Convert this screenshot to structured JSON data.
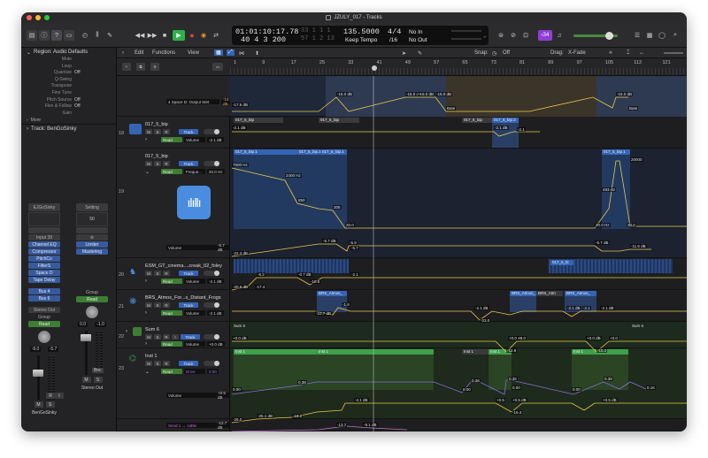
{
  "window": {
    "title": "JZULY_017 - Tracks",
    "traffic_colors": [
      "#fe5f57",
      "#febc2e",
      "#28c840"
    ]
  },
  "control_bar": {
    "lcd": {
      "time": "01:01:10:17.78",
      "time_ghost": "33 1 1 1",
      "bars": "40 4 3 200",
      "bars_ghost": "57 1 2 13",
      "tempo": "135.5000",
      "tempo_mode": "Keep Tempo",
      "signature": "4/4",
      "division": "/16",
      "in": "No In",
      "out": "No Out"
    },
    "count_badge": "‹34",
    "play_color": "#2fb24a",
    "record_color": "#e2403a",
    "badge_color": "#8f3fd4"
  },
  "inspector": {
    "region_header": "Region: Audio Defaults",
    "params": [
      {
        "name": "Mute",
        "value": ""
      },
      {
        "name": "Loop",
        "value": ""
      },
      {
        "name": "Quantize",
        "value": "Off"
      },
      {
        "name": "Q-Swing",
        "value": ""
      },
      {
        "name": "Transpose",
        "value": ""
      },
      {
        "name": "Fine Tune",
        "value": ""
      },
      {
        "name": "Pitch Source",
        "value": "Off"
      },
      {
        "name": "Flex & Follow",
        "value": "Off"
      },
      {
        "name": "Gain",
        "value": ""
      }
    ],
    "more": "More",
    "track_header": "Track: BenGoSinky",
    "strip_left": {
      "eq": "EJGoSinky",
      "input": "Input 39",
      "plugins": [
        "Channel EQ",
        "Compressor",
        "PitchCo",
        "FilterS",
        "Space D",
        "Tape Delay"
      ],
      "sends": [
        "Bus 4",
        "Bus 6"
      ],
      "output": "Stereo Out",
      "group": "Group",
      "automation": "Read",
      "values": [
        "-9.0",
        "-5.7"
      ],
      "name": "BenGoSinky",
      "buttons": [
        "M",
        "S"
      ]
    },
    "strip_right": {
      "eq": "Setting",
      "fx_value": "50",
      "plugins": [
        "Limiter",
        "Mastering"
      ],
      "group": "Group",
      "automation": "Read",
      "values": [
        "0.0",
        "-1.0"
      ],
      "name": "Stereo Out",
      "bnc": "Bnc",
      "buttons": [
        "M",
        "S"
      ]
    }
  },
  "editor_bar": {
    "edit": "Edit",
    "functions": "Functions",
    "view": "View",
    "snap_label": "Snap:",
    "snap_value": "Off",
    "drag_label": "Drag:",
    "drag_value": "X-Fade"
  },
  "ruler": {
    "marks": [
      "1",
      "9",
      "17",
      "25",
      "33",
      "41",
      "49",
      "57",
      "65",
      "73",
      "81",
      "89",
      "97",
      "105",
      "113",
      "121"
    ]
  },
  "tracks": [
    {
      "num": "",
      "name": "",
      "sub": "4 Space D: Output Wet",
      "value": "-14.6 dB"
    },
    {
      "num": "18",
      "name": "017_5_bip",
      "mode": "Read",
      "param": "Volume",
      "value": "-2.1 dB"
    },
    {
      "num": "19",
      "name": "017_5_bip",
      "mode": "Read",
      "param": "Freque...",
      "value": "20.0 Hz",
      "param2": "Volume",
      "value2": "-5.7 dB"
    },
    {
      "num": "20",
      "name": "ESM_GT_cinema....creak_02_foley",
      "mode": "Read",
      "param": "Volume",
      "value": "-2.1 dB"
    },
    {
      "num": "21",
      "name": "BRS_Atmos_For...s_Distant_Frogs",
      "mode": "Read",
      "param": "Volume",
      "value": "-2.1 dB"
    },
    {
      "num": "22",
      "name": "Sum 6",
      "mode": "Read",
      "param": "Volume",
      "value": "+0.0 dB"
    },
    {
      "num": "23",
      "name": "Inst 1",
      "mode": "Read",
      "param": "Drive",
      "value": "0.00",
      "param2": "Volume",
      "value2": "+0.5 dB"
    },
    {
      "num": "",
      "name": "",
      "sub": "Send 1 → cable",
      "value": "-12.7 dB"
    }
  ],
  "regions": {
    "r18a": "017_5_bip",
    "r18b": "017_5_bip",
    "r18c": "017_5_bip",
    "r18d": "017_5_bip.2",
    "r19a": "017_5_bip.1",
    "r19b": "017_5_bip.1",
    "r19c": "017_5_bip.1",
    "r19d": "017_5_bip.1",
    "r20": "017_5_bi",
    "r21a": "BRS_Atmos_",
    "r21b": "BRS_Atmos_",
    "r21c": "BRS_Atm",
    "r21d": "BRS_Atmos_",
    "r22a": "Sum 6",
    "r22b": "Sum 6",
    "r23a": "Inst 1",
    "r23b": "Inst 1",
    "r23c": "Inst 1",
    "r23d": "Inst 1",
    "r23e": "Inst 1"
  },
  "automation_labels": {
    "a0": [
      "-17.6 dB",
      "-15.0 dB",
      "-15.0 dB",
      "-15.0 dB",
      "-15.0 dB",
      "-15.0 dB",
      "Bate",
      "Bate"
    ],
    "a18": [
      "-2.1 dB",
      "-2.1 dB",
      "-2.1"
    ],
    "a19": [
      "7500 Hz",
      "2400 Hz",
      "850",
      "205",
      "20.0",
      "20000",
      "493 Hz",
      "20.0 Hz",
      "20.0"
    ],
    "a19v": [
      "-22.4 dB",
      "-5.7 dB",
      "-5.9",
      "-5.7",
      "-5.7 dB",
      "-11.6 dB"
    ],
    "a20": [
      "-20.6 dB",
      "-17.4",
      "-6.2",
      "-0.7 dB",
      "-10.8",
      "-2.1"
    ],
    "a21": [
      "-10.7 dB",
      "-1.8",
      "-2.1 dB",
      "-23.0",
      "-2.1 dB",
      "-2.1",
      "-2.1 dB"
    ],
    "a22": [
      "+0.0 dB",
      "+0.0 dB",
      "+0.0",
      "-12.9",
      "+0.0 dB",
      "+0.0",
      "-10.2"
    ],
    "a23": [
      "0.00",
      "0.38",
      "0.00",
      "0.38",
      "0.00",
      "0.16",
      "0.00",
      "0.35",
      "0.38"
    ],
    "a23v": [
      "-26.0",
      "-25.1 dB",
      "-18.2",
      "-4.1 dB",
      "+0.5",
      "+0.5 dB",
      "-16.4",
      "+0.5 dB"
    ],
    "a24": [
      "-13.7",
      "-9.1 dB"
    ]
  }
}
